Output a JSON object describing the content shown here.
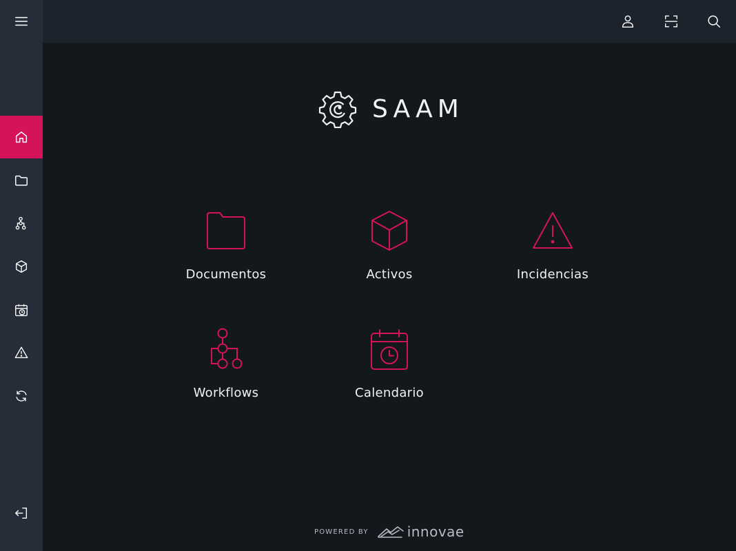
{
  "app": {
    "name": "SAAM"
  },
  "colors": {
    "accent": "#d5135a",
    "sidebar": "#262d38",
    "topbar": "#1d232c",
    "background": "#13181d"
  },
  "sidebar": {
    "items": [
      {
        "icon": "menu-icon"
      },
      {
        "icon": "home-icon",
        "active": true
      },
      {
        "icon": "folder-icon"
      },
      {
        "icon": "workflow-icon"
      },
      {
        "icon": "cube-icon"
      },
      {
        "icon": "calendar-clock-icon"
      },
      {
        "icon": "warning-icon"
      },
      {
        "icon": "sync-icon"
      },
      {
        "icon": "logout-icon"
      }
    ]
  },
  "topbar": {
    "icons": [
      "user-icon",
      "scan-icon",
      "search-icon"
    ]
  },
  "tiles": [
    {
      "label": "Documentos",
      "icon": "folder-icon"
    },
    {
      "label": "Activos",
      "icon": "cube-icon"
    },
    {
      "label": "Incidencias",
      "icon": "warning-icon"
    },
    {
      "label": "Workflows",
      "icon": "workflow-icon"
    },
    {
      "label": "Calendario",
      "icon": "calendar-clock-icon"
    }
  ],
  "footer": {
    "powered_by": "POWERED BY",
    "brand": "innovae"
  }
}
